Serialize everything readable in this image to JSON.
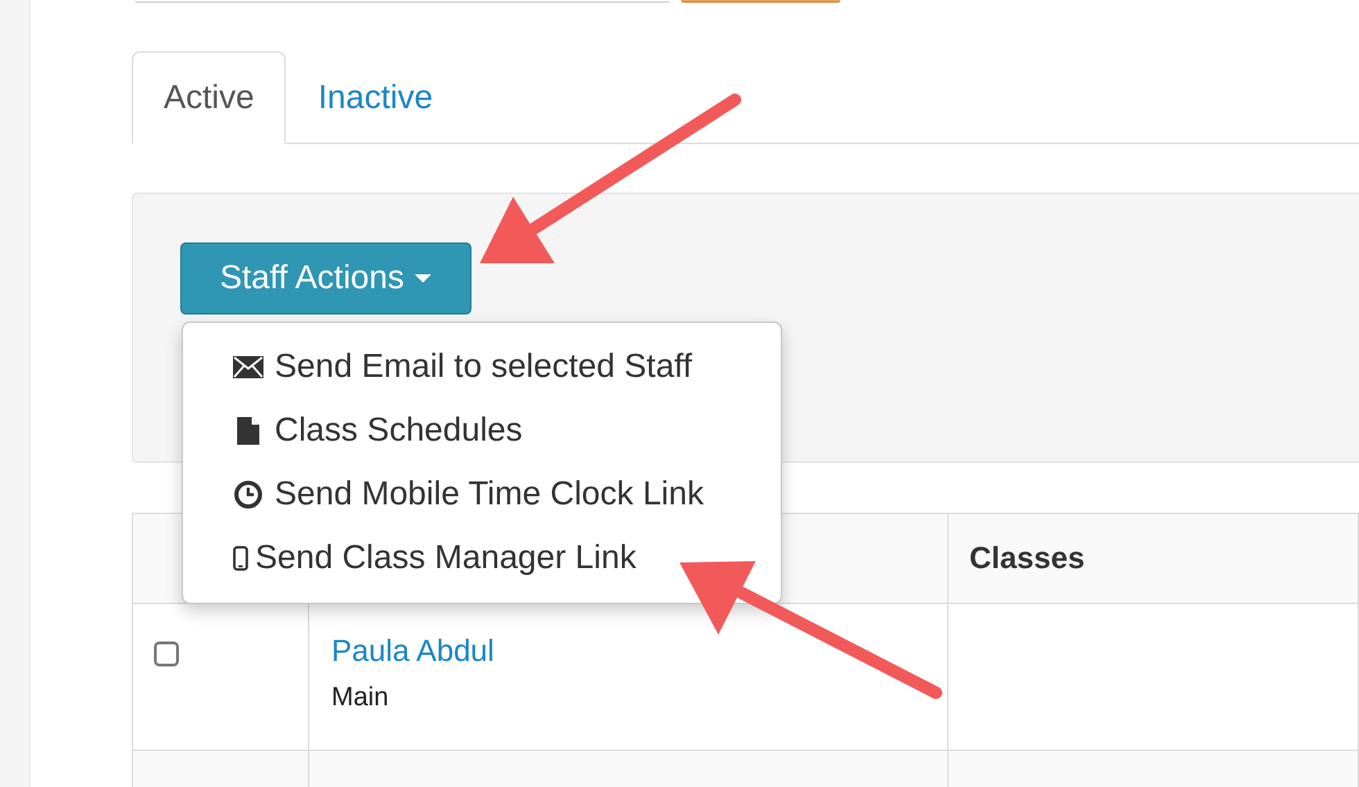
{
  "tabs": [
    {
      "label": "Active",
      "selected": true
    },
    {
      "label": "Inactive",
      "selected": false
    }
  ],
  "actions_button": {
    "label": "Staff Actions",
    "expanded": true
  },
  "actions_menu": [
    {
      "kind": "email",
      "label": "Send Email to selected Staff"
    },
    {
      "kind": "file",
      "label": "Class Schedules"
    },
    {
      "kind": "clock",
      "label": "Send Mobile Time Clock Link"
    },
    {
      "kind": "mobile",
      "label": "Send Class Manager Link"
    }
  ],
  "table": {
    "columns": [
      "",
      "",
      "Classes"
    ],
    "rows": [
      {
        "checked": false,
        "name": "Paula Abdul",
        "location": "Main"
      },
      {}
    ]
  }
}
